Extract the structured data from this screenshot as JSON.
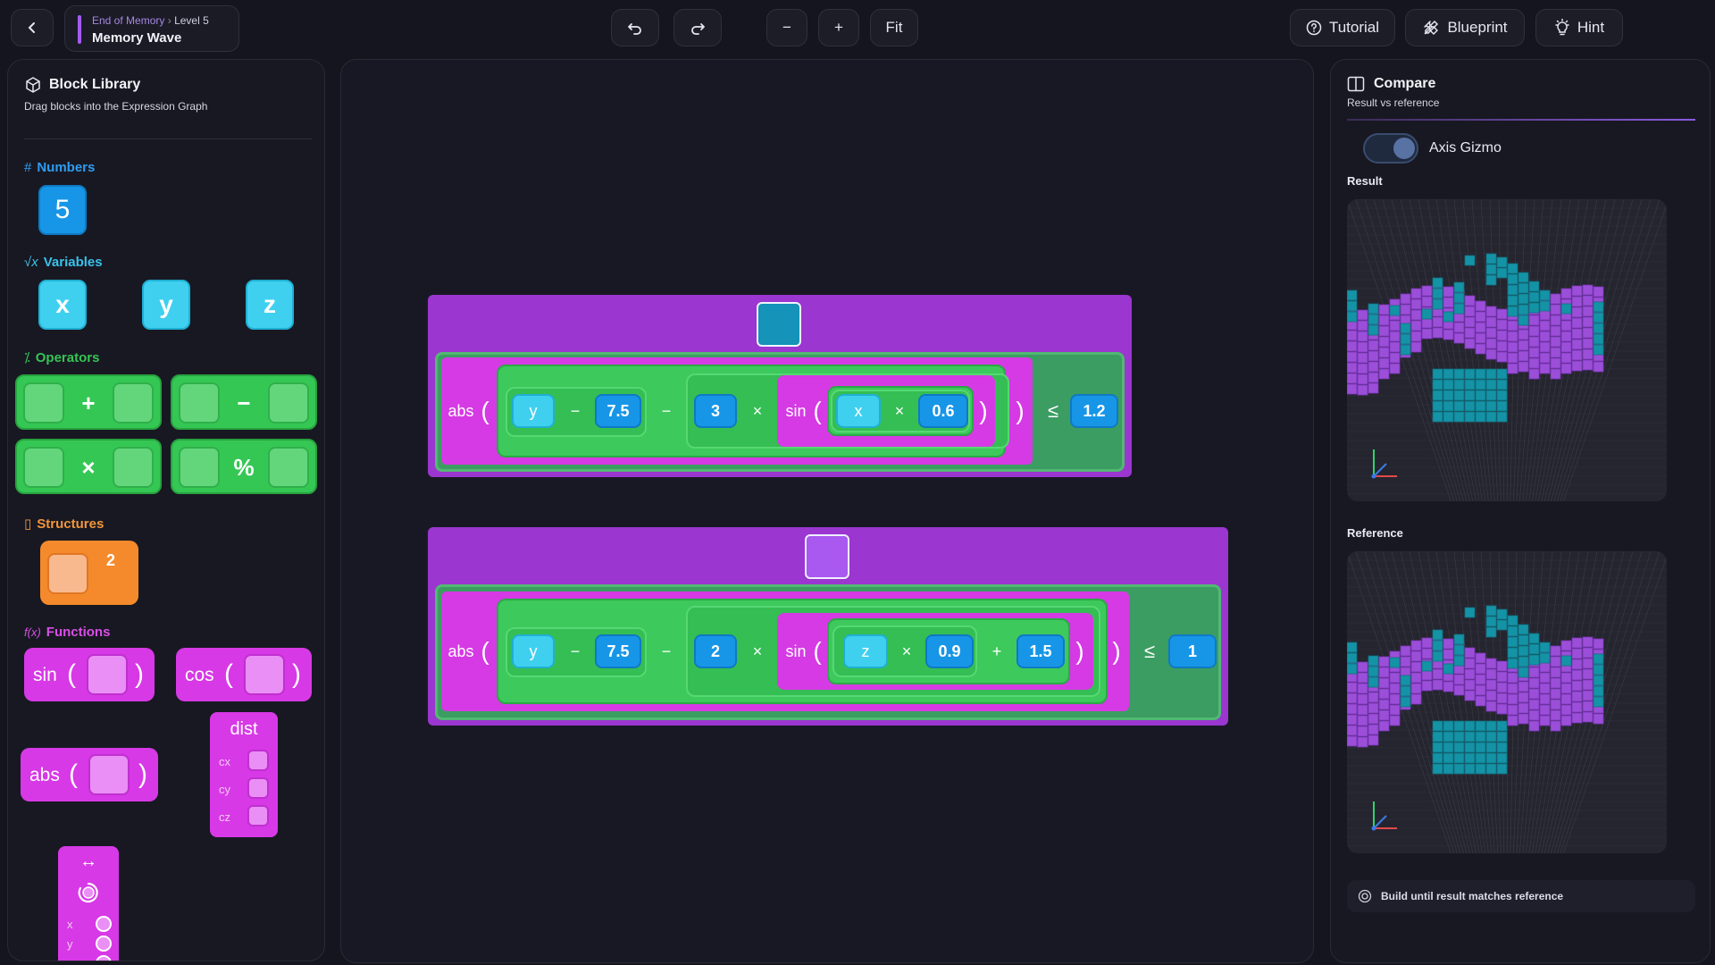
{
  "header": {
    "breadcrumb_parent": "End of Memory",
    "breadcrumb_level": "Level 5",
    "title": "Memory Wave",
    "zoom_out": "−",
    "zoom_in": "+",
    "fit": "Fit",
    "tutorial": "Tutorial",
    "blueprint": "Blueprint",
    "hint": "Hint"
  },
  "library": {
    "title": "Block Library",
    "subtitle": "Drag blocks into the Expression Graph",
    "numbers_title": "Numbers",
    "number_value": "5",
    "variables_title": "Variables",
    "variables": [
      "x",
      "y",
      "z"
    ],
    "operators_title": "Operators",
    "operators": [
      "+",
      "−",
      "×",
      "%"
    ],
    "structures_title": "Structures",
    "power_exponent": "2",
    "functions_title": "Functions",
    "functions": [
      "sin",
      "cos",
      "abs"
    ],
    "dist": {
      "label": "dist",
      "args": [
        "cx",
        "cy",
        "cz"
      ]
    },
    "transform": {
      "symbol": "↔",
      "args": [
        "x",
        "y"
      ]
    }
  },
  "colors": {
    "rule1": "#1593b8",
    "rule2": "#a958f0",
    "variables": "#3fd0f0",
    "numbers": "#1796e8",
    "operators": "#35c754",
    "functions": "#d739e6",
    "structures": "#f58a2c",
    "teal_voxel": "#1593a6",
    "purple_voxel": "#9b4fd8"
  },
  "graph": {
    "rule1": {
      "fn": "abs",
      "var1": "y",
      "op1": "−",
      "num1": "7.5",
      "op2": "−",
      "num2": "3",
      "op3": "×",
      "fn2": "sin",
      "var2": "x",
      "op4": "×",
      "num3": "0.6",
      "cmp": "≤",
      "threshold": "1.2"
    },
    "rule2": {
      "fn": "abs",
      "var1": "y",
      "op1": "−",
      "num1": "7.5",
      "op2": "−",
      "num2": "2",
      "op3": "×",
      "fn2": "sin",
      "var2": "z",
      "op4": "×",
      "num3": "0.9",
      "op5": "+",
      "num4": "1.5",
      "cmp": "≤",
      "threshold": "1"
    }
  },
  "compare": {
    "title": "Compare",
    "subtitle": "Result vs reference",
    "toggle_label": "Axis Gizmo",
    "result_label": "Result",
    "reference_label": "Reference",
    "footer": "Build until result matches reference"
  }
}
